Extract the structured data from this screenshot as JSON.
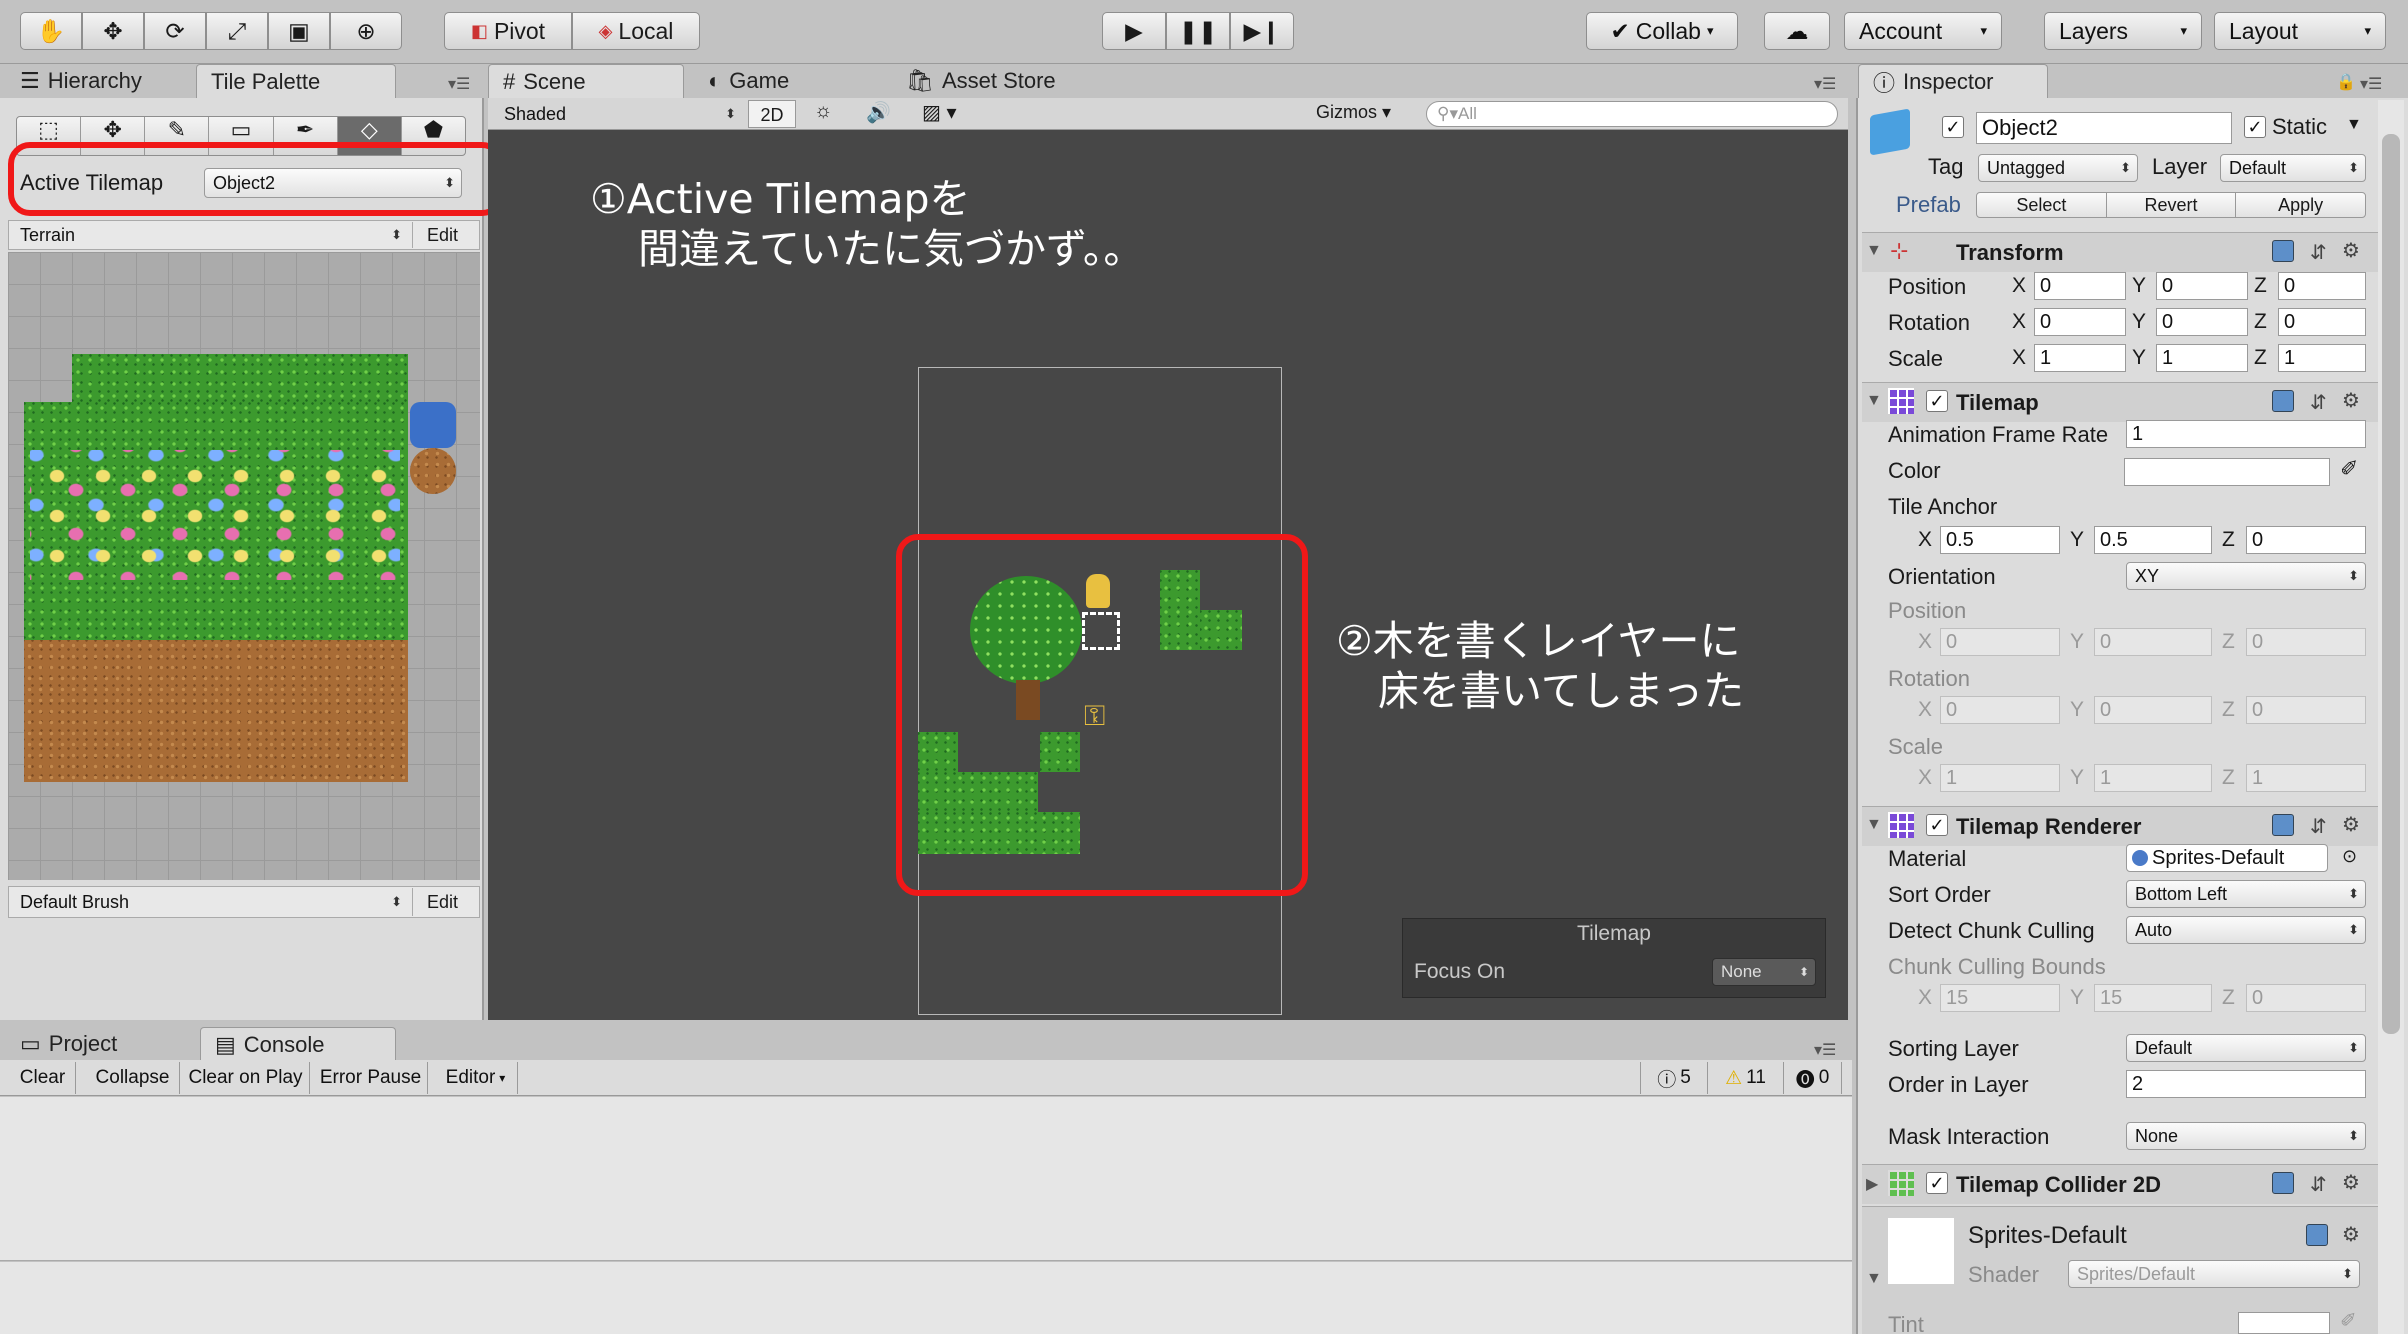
{
  "toolbar": {
    "pivot": "Pivot",
    "local": "Local",
    "collab": "Collab",
    "account": "Account",
    "layers": "Layers",
    "layout": "Layout"
  },
  "left_tabs": {
    "hierarchy": "Hierarchy",
    "tile_palette": "Tile Palette"
  },
  "center_tabs": {
    "scene": "Scene",
    "game": "Game",
    "asset_store": "Asset Store"
  },
  "inspector_tab": "Inspector",
  "palette": {
    "active_tilemap_label": "Active Tilemap",
    "active_tilemap_value": "Object2",
    "palette_name": "Terrain",
    "edit": "Edit",
    "brush": "Default Brush",
    "brush_edit": "Edit"
  },
  "scene_bar": {
    "shading": "Shaded",
    "mode_2d": "2D",
    "gizmos": "Gizmos",
    "search_placeholder": "All"
  },
  "annotations": {
    "note1_line1": "①Active Tilemapを",
    "note1_line2": "間違えていたに気づかず。。",
    "note2_line1": "②木を書くレイヤーに",
    "note2_line2": "床を書いてしまった"
  },
  "overlay": {
    "title": "Tilemap",
    "focus_label": "Focus On",
    "focus_value": "None"
  },
  "bottom_tabs": {
    "project": "Project",
    "console": "Console"
  },
  "console": {
    "clear": "Clear",
    "collapse": "Collapse",
    "clear_on_play": "Clear on Play",
    "error_pause": "Error Pause",
    "editor": "Editor",
    "info_count": "5",
    "warn_count": "11",
    "error_count": "0"
  },
  "inspector": {
    "object_name": "Object2",
    "static": "Static",
    "tag_label": "Tag",
    "tag_value": "Untagged",
    "layer_label": "Layer",
    "layer_value": "Default",
    "prefab": "Prefab",
    "select": "Select",
    "revert": "Revert",
    "apply": "Apply",
    "transform": {
      "title": "Transform",
      "position": "Position",
      "rotation": "Rotation",
      "scale": "Scale",
      "pos": [
        "0",
        "0",
        "0"
      ],
      "rot": [
        "0",
        "0",
        "0"
      ],
      "scl": [
        "1",
        "1",
        "1"
      ]
    },
    "tilemap": {
      "title": "Tilemap",
      "anim_label": "Animation Frame Rate",
      "anim_value": "1",
      "color": "Color",
      "tile_anchor": "Tile Anchor",
      "anchor": [
        "0.5",
        "0.5",
        "0"
      ],
      "orientation": "Orientation",
      "orientation_value": "XY",
      "position": "Position",
      "pos": [
        "0",
        "0",
        "0"
      ],
      "rotation": "Rotation",
      "rot": [
        "0",
        "0",
        "0"
      ],
      "scale": "Scale",
      "scl": [
        "1",
        "1",
        "1"
      ]
    },
    "renderer": {
      "title": "Tilemap Renderer",
      "material": "Material",
      "material_value": "Sprites-Default",
      "sort_order": "Sort Order",
      "sort_value": "Bottom Left",
      "detect": "Detect Chunk Culling",
      "detect_value": "Auto",
      "bounds": "Chunk Culling Bounds",
      "bounds_vals": [
        "15",
        "15",
        "0"
      ],
      "sorting_layer": "Sorting Layer",
      "sorting_value": "Default",
      "order": "Order in Layer",
      "order_value": "2",
      "mask": "Mask Interaction",
      "mask_value": "None"
    },
    "collider": {
      "title": "Tilemap Collider 2D"
    },
    "material_preview": {
      "name": "Sprites-Default",
      "shader_label": "Shader",
      "shader_value": "Sprites/Default",
      "tint": "Tint"
    }
  },
  "axes": {
    "x": "X",
    "y": "Y",
    "z": "Z"
  }
}
